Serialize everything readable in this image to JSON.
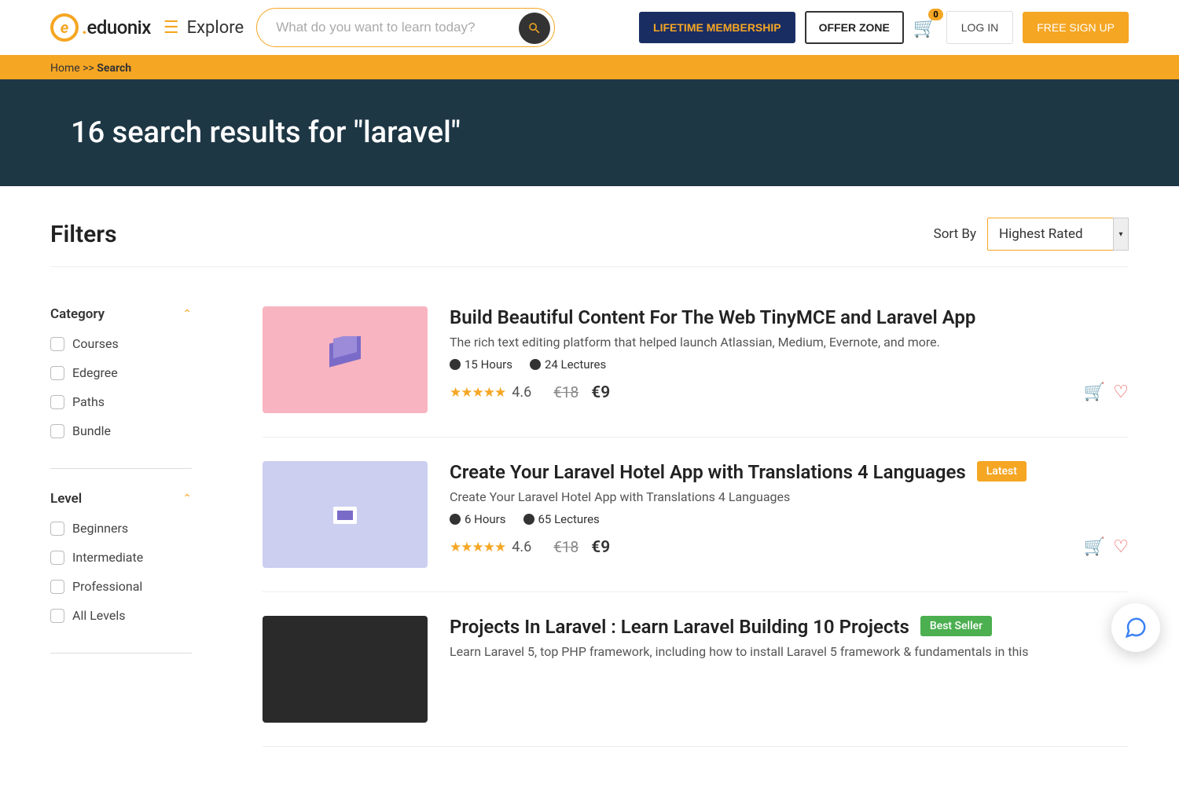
{
  "header": {
    "logo_text": "eduonix",
    "explore": "Explore",
    "search_placeholder": "What do you want to learn today?",
    "membership": "LIFETIME MEMBERSHIP",
    "offer": "OFFER ZONE",
    "cart_count": "0",
    "login": "LOG IN",
    "signup": "FREE SIGN UP"
  },
  "breadcrumb": {
    "home": "Home",
    "separator": " >> ",
    "current": "Search"
  },
  "hero": {
    "title": "16 search results for \"laravel\""
  },
  "filters_title": "Filters",
  "sort": {
    "label": "Sort By",
    "selected": "Highest Rated"
  },
  "filter_sections": [
    {
      "title": "Category",
      "options": [
        "Courses",
        "Edegree",
        "Paths",
        "Bundle"
      ]
    },
    {
      "title": "Level",
      "options": [
        "Beginners",
        "Intermediate",
        "Professional",
        "All Levels"
      ]
    }
  ],
  "courses": [
    {
      "title": "Build Beautiful Content For The Web TinyMCE and Laravel App",
      "desc": "The rich text editing platform that helped launch Atlassian, Medium, Evernote, and more.",
      "hours": "15 Hours",
      "lectures": "24 Lectures",
      "rating": "4.6",
      "old_price": "€18",
      "new_price": "€9",
      "thumb_class": "thumb-pink",
      "badge": null
    },
    {
      "title": "Create Your Laravel Hotel App with Translations 4 Languages",
      "desc": "Create Your Laravel Hotel App with Translations 4 Languages",
      "hours": "6 Hours",
      "lectures": "65 Lectures",
      "rating": "4.6",
      "old_price": "€18",
      "new_price": "€9",
      "thumb_class": "thumb-purple",
      "badge": "Latest",
      "badge_class": "badge-latest"
    },
    {
      "title": "Projects In Laravel : Learn Laravel Building 10 Projects",
      "desc": "Learn Laravel 5, top PHP framework, including how to install Laravel 5 framework & fundamentals in this",
      "hours": "",
      "lectures": "",
      "rating": "",
      "old_price": "",
      "new_price": "",
      "thumb_class": "thumb-dark",
      "badge": "Best Seller",
      "badge_class": "badge-best"
    }
  ]
}
